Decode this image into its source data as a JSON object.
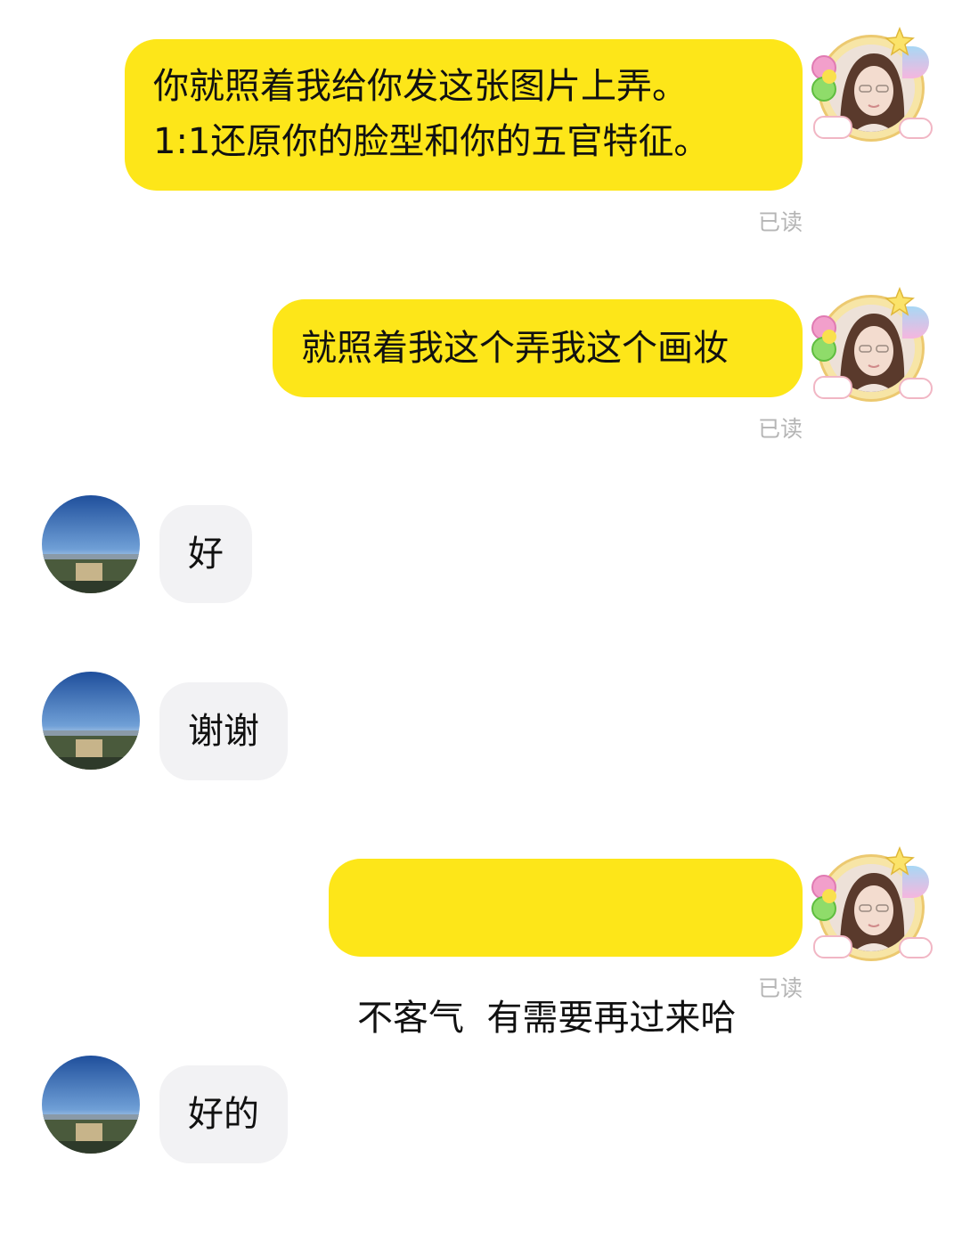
{
  "chat": {
    "messages": [
      {
        "direction": "outgoing",
        "lines": [
          "你就照着我给你发这张图片上弄。",
          "1:1还原你的脸型和你的五官特征。"
        ],
        "read_status": "已读"
      },
      {
        "direction": "outgoing",
        "lines": [
          "就照着我这个弄我这个画妆"
        ],
        "read_status": "已读"
      },
      {
        "direction": "incoming",
        "lines": [
          "好"
        ]
      },
      {
        "direction": "incoming",
        "lines": [
          "谢谢"
        ]
      },
      {
        "direction": "outgoing",
        "lines": [
          "不客气  有需要再过来哈"
        ],
        "read_status": "已读"
      },
      {
        "direction": "incoming",
        "lines": [
          "好的"
        ]
      }
    ]
  },
  "colors": {
    "outgoing_bubble": "#fde619",
    "incoming_bubble": "#f2f2f4",
    "read_receipt": "#b5b5b5",
    "background": "#ffffff"
  },
  "avatars": {
    "me": "girl-selfie-with-balloon-frame",
    "other": "blue-sky-landscape"
  }
}
